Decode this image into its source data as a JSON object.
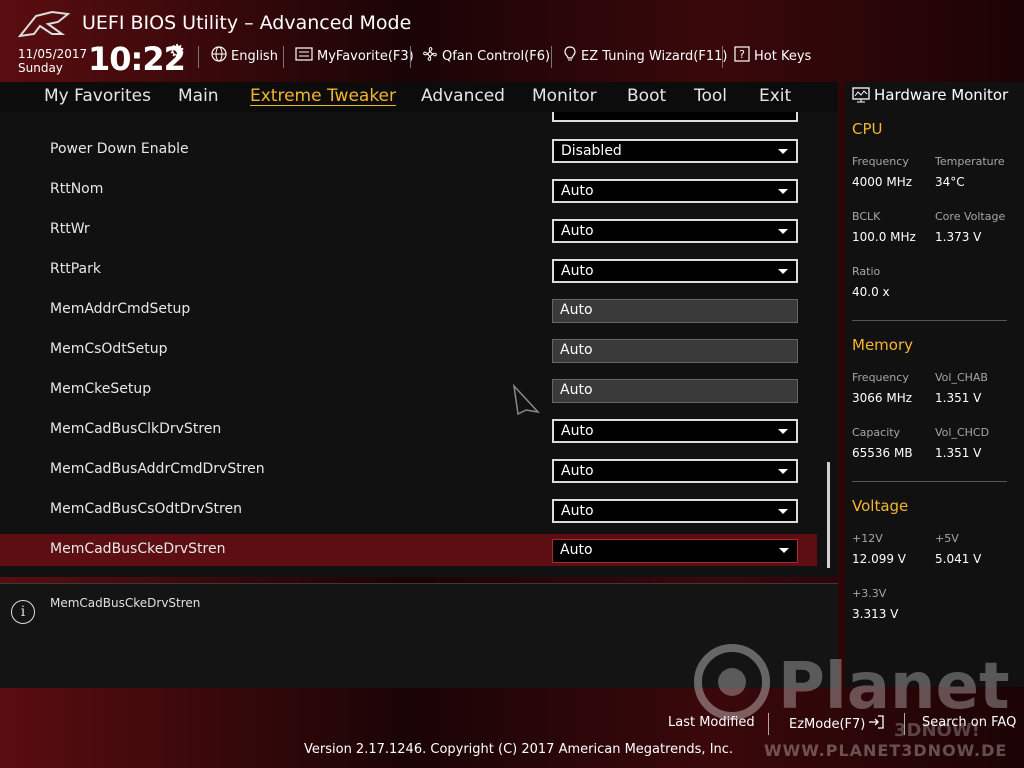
{
  "header": {
    "title": "UEFI BIOS Utility – Advanced Mode",
    "date": "11/05/2017",
    "day": "Sunday",
    "time": "10:22",
    "items": [
      {
        "label": "English",
        "icon": "globe-icon"
      },
      {
        "label": "MyFavorite(F3)",
        "icon": "favorite-icon"
      },
      {
        "label": "Qfan Control(F6)",
        "icon": "fan-icon"
      },
      {
        "label": "EZ Tuning Wizard(F11)",
        "icon": "bulb-icon"
      },
      {
        "label": "Hot Keys",
        "icon": "question-icon"
      }
    ]
  },
  "nav": {
    "tabs": [
      {
        "label": "My Favorites"
      },
      {
        "label": "Main"
      },
      {
        "label": "Extreme Tweaker",
        "active": true
      },
      {
        "label": "Advanced"
      },
      {
        "label": "Monitor"
      },
      {
        "label": "Boot"
      },
      {
        "label": "Tool"
      },
      {
        "label": "Exit"
      }
    ]
  },
  "settings": [
    {
      "label": "Power Down Enable",
      "value": "Disabled",
      "editable": true
    },
    {
      "label": "RttNom",
      "value": "Auto",
      "editable": true
    },
    {
      "label": "RttWr",
      "value": "Auto",
      "editable": true
    },
    {
      "label": "RttPark",
      "value": "Auto",
      "editable": true
    },
    {
      "label": "MemAddrCmdSetup",
      "value": "Auto",
      "editable": false
    },
    {
      "label": "MemCsOdtSetup",
      "value": "Auto",
      "editable": false
    },
    {
      "label": "MemCkeSetup",
      "value": "Auto",
      "editable": false
    },
    {
      "label": "MemCadBusClkDrvStren",
      "value": "Auto",
      "editable": true
    },
    {
      "label": "MemCadBusAddrCmdDrvStren",
      "value": "Auto",
      "editable": true
    },
    {
      "label": "MemCadBusCsOdtDrvStren",
      "value": "Auto",
      "editable": true
    },
    {
      "label": "MemCadBusCkeDrvStren",
      "value": "Auto",
      "editable": true,
      "selected": true
    }
  ],
  "help": {
    "text": "MemCadBusCkeDrvStren"
  },
  "hardware_monitor": {
    "title": "Hardware Monitor",
    "cpu": {
      "title": "CPU",
      "frequency_label": "Frequency",
      "frequency": "4000 MHz",
      "temperature_label": "Temperature",
      "temperature": "34°C",
      "bclk_label": "BCLK",
      "bclk": "100.0 MHz",
      "core_voltage_label": "Core Voltage",
      "core_voltage": "1.373 V",
      "ratio_label": "Ratio",
      "ratio": "40.0 x"
    },
    "memory": {
      "title": "Memory",
      "frequency_label": "Frequency",
      "frequency": "3066 MHz",
      "vol_chab_label": "Vol_CHAB",
      "vol_chab": "1.351 V",
      "capacity_label": "Capacity",
      "capacity": "65536 MB",
      "vol_chcd_label": "Vol_CHCD",
      "vol_chcd": "1.351 V"
    },
    "voltage": {
      "title": "Voltage",
      "v12_label": "+12V",
      "v12": "12.099 V",
      "v5_label": "+5V",
      "v5": "5.041 V",
      "v33_label": "+3.3V",
      "v33": "3.313 V"
    }
  },
  "footer": {
    "last_modified": "Last Modified",
    "ezmode": "EzMode(F7)",
    "search": "Search on FAQ",
    "copyright": "Version 2.17.1246. Copyright (C) 2017 American Megatrends, Inc."
  },
  "watermark": {
    "brand": "Planet",
    "sub": "3DNOW!",
    "url": "WWW.PLANET3DNOW.DE"
  },
  "colors": {
    "accent": "#f3b52c",
    "selected_row": "#5c0e12",
    "background": "#111111"
  }
}
